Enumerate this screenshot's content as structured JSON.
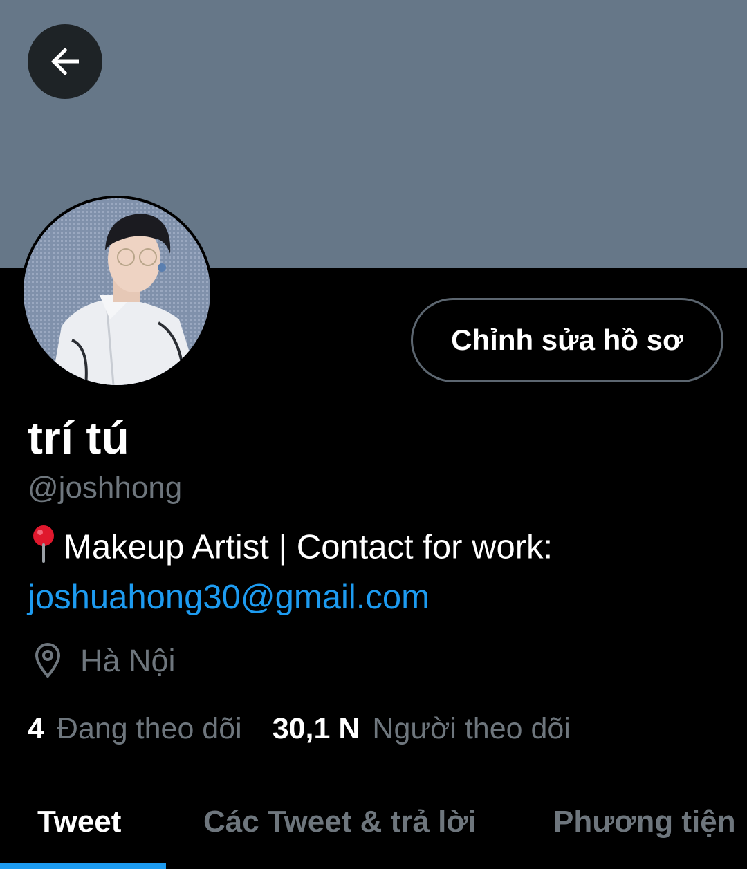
{
  "profile": {
    "display_name": "trí tú",
    "handle": "@joshhong",
    "bio_text": "Makeup Artist | Contact for work:",
    "bio_emoji": "round-pushpin-icon",
    "bio_email": "joshuahong30@gmail.com",
    "location": "Hà Nội",
    "following_count": "4",
    "following_label": "Đang theo dõi",
    "followers_count": "30,1 N",
    "followers_label": "Người theo dõi"
  },
  "actions": {
    "edit_profile_label": "Chỉnh sửa hồ sơ",
    "back_icon": "arrow-left-icon"
  },
  "tabs": [
    {
      "label": "Tweet",
      "active": true
    },
    {
      "label": "Các Tweet & trả lời",
      "active": false
    },
    {
      "label": "Phương tiện",
      "active": false
    }
  ],
  "colors": {
    "banner": "#667788",
    "background": "#000000",
    "accent": "#1d9bf0",
    "secondary_text": "#6e767d"
  }
}
